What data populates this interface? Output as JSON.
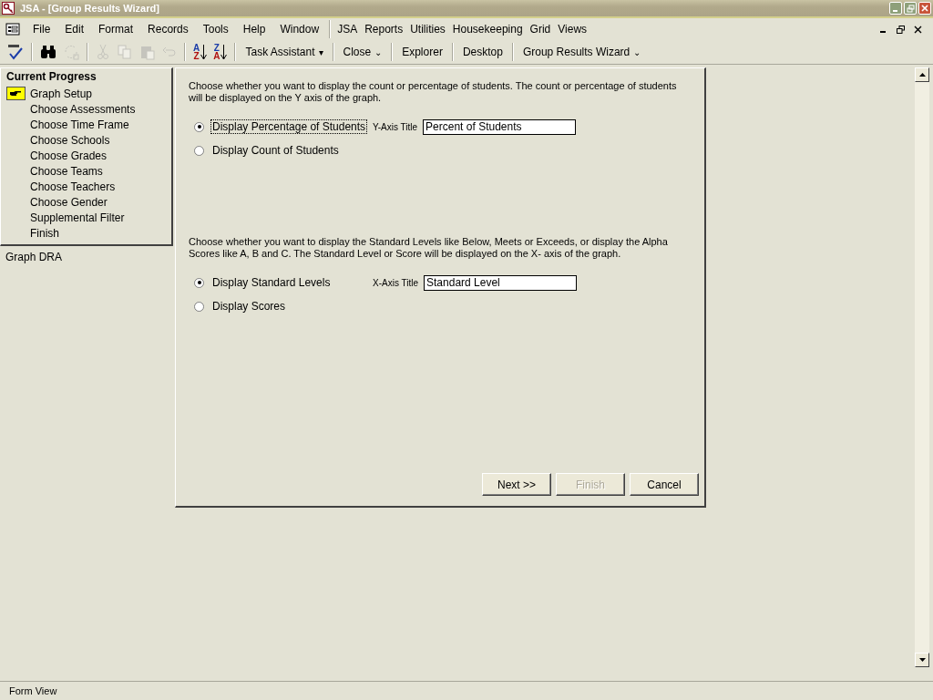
{
  "window": {
    "title": "JSA - [Group Results Wizard]"
  },
  "menu_bar": {
    "items": [
      {
        "label": "File"
      },
      {
        "label": "Edit"
      },
      {
        "label": "Format"
      },
      {
        "label": "Records"
      },
      {
        "label": "Tools"
      },
      {
        "label": "Help"
      },
      {
        "label": "Window"
      }
    ],
    "custom_items": [
      {
        "label": "JSA"
      },
      {
        "label": "Reports"
      },
      {
        "label": "Utilities"
      },
      {
        "label": "Housekeeping"
      },
      {
        "label": "Grid"
      },
      {
        "label": "Views"
      }
    ]
  },
  "toolbar": {
    "items": [
      {
        "kind": "spelling",
        "disabled": false
      },
      {
        "kind": "separator"
      },
      {
        "kind": "find",
        "disabled": false
      },
      {
        "kind": "replace",
        "disabled": true
      },
      {
        "kind": "separator"
      },
      {
        "kind": "cut",
        "disabled": true
      },
      {
        "kind": "copy",
        "disabled": true
      },
      {
        "kind": "paste",
        "disabled": true
      },
      {
        "kind": "undo",
        "disabled": true
      },
      {
        "kind": "separator"
      },
      {
        "kind": "sort-asc",
        "disabled": false,
        "top": "A",
        "bottom": "Z"
      },
      {
        "kind": "sort-desc",
        "disabled": false,
        "top": "Z",
        "bottom": "A"
      },
      {
        "kind": "separator"
      },
      {
        "kind": "dropdown",
        "label": "Task Assistant",
        "caret": "▾"
      },
      {
        "kind": "separator"
      },
      {
        "kind": "dropdown",
        "label": "Close",
        "caret": "⌄"
      },
      {
        "kind": "separator"
      },
      {
        "kind": "text",
        "label": "Explorer"
      },
      {
        "kind": "separator"
      },
      {
        "kind": "text",
        "label": "Desktop"
      },
      {
        "kind": "separator"
      },
      {
        "kind": "dropdown",
        "label": "Group Results Wizard",
        "caret": "⌄"
      }
    ]
  },
  "progress": {
    "title": "Current Progress",
    "steps": [
      {
        "label": "Graph Setup",
        "selected": true
      },
      {
        "label": "Choose Assessments",
        "selected": false
      },
      {
        "label": "Choose Time Frame",
        "selected": false
      },
      {
        "label": "Choose Schools",
        "selected": false
      },
      {
        "label": "Choose Grades",
        "selected": false
      },
      {
        "label": "Choose Teams",
        "selected": false
      },
      {
        "label": "Choose Teachers",
        "selected": false
      },
      {
        "label": "Choose Gender",
        "selected": false
      },
      {
        "label": "Supplemental Filter",
        "selected": false
      },
      {
        "label": "Finish",
        "selected": false
      }
    ],
    "graph_name": "Graph DRA"
  },
  "sections": [
    {
      "instructions": "Choose whether you want to display the count or percentage of students. The count or percentage of students will be displayed on the Y axis of the graph.",
      "options": [
        {
          "label": "Display Percentage of Students",
          "selected": true,
          "focused": true
        },
        {
          "label": "Display Count of Students",
          "selected": false,
          "focused": false
        }
      ],
      "field_label": "Y-Axis Title",
      "field_value": "Percent of Students"
    },
    {
      "instructions": "Choose whether you want to display the Standard Levels like Below, Meets or Exceeds, or display the Alpha Scores like A, B and C. The Standard Level or Score will be displayed on the X- axis of the graph.",
      "options": [
        {
          "label": "Display Standard Levels",
          "selected": true,
          "focused": false
        },
        {
          "label": "Display Scores",
          "selected": false,
          "focused": false
        }
      ],
      "field_label": "X-Axis Title",
      "field_value": "Standard Level"
    }
  ],
  "buttons": [
    {
      "label": "Next >>",
      "disabled": false
    },
    {
      "label": "Finish",
      "disabled": true
    },
    {
      "label": "Cancel",
      "disabled": false
    }
  ],
  "status_bar": {
    "text": "Form View"
  }
}
